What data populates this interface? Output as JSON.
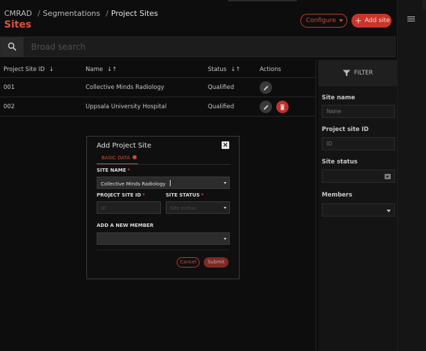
{
  "breadcrumb": {
    "items": [
      "CMRAD",
      "Segmentations",
      "Project Sites"
    ]
  },
  "page_title": "Sites",
  "header": {
    "configure_label": "Configure",
    "add_site_label": "Add site"
  },
  "search": {
    "placeholder": "Broad search"
  },
  "table": {
    "columns": [
      "Project Site ID",
      "Name",
      "Status",
      "Actions"
    ],
    "rows": [
      {
        "id": "001",
        "name": "Collective Minds Radiology",
        "status": "Qualified"
      },
      {
        "id": "002",
        "name": "Uppsala University Hospital",
        "status": "Qualified"
      }
    ]
  },
  "filter": {
    "title": "FILTER",
    "site_name_label": "Site name",
    "site_name_placeholder": "Name",
    "project_site_id_label": "Project site ID",
    "project_site_id_placeholder": "ID",
    "site_status_label": "Site status",
    "members_label": "Members"
  },
  "modal": {
    "title": "Add Project Site",
    "tab_label": "BASIC DATA",
    "site_name_label": "SITE NAME",
    "site_name_value": "Collective Minds Radiology",
    "project_site_id_label": "PROJECT SITE ID",
    "project_site_id_placeholder": "ID",
    "site_status_label": "SITE STATUS",
    "site_status_placeholder": "Site status",
    "add_member_label": "ADD A NEW MEMBER",
    "cancel_label": "Cancel",
    "submit_label": "Submit",
    "required_marker": "*"
  },
  "colors": {
    "accent": "#d04a38",
    "background": "#0d0d0d",
    "delete": "#c42f2f"
  }
}
